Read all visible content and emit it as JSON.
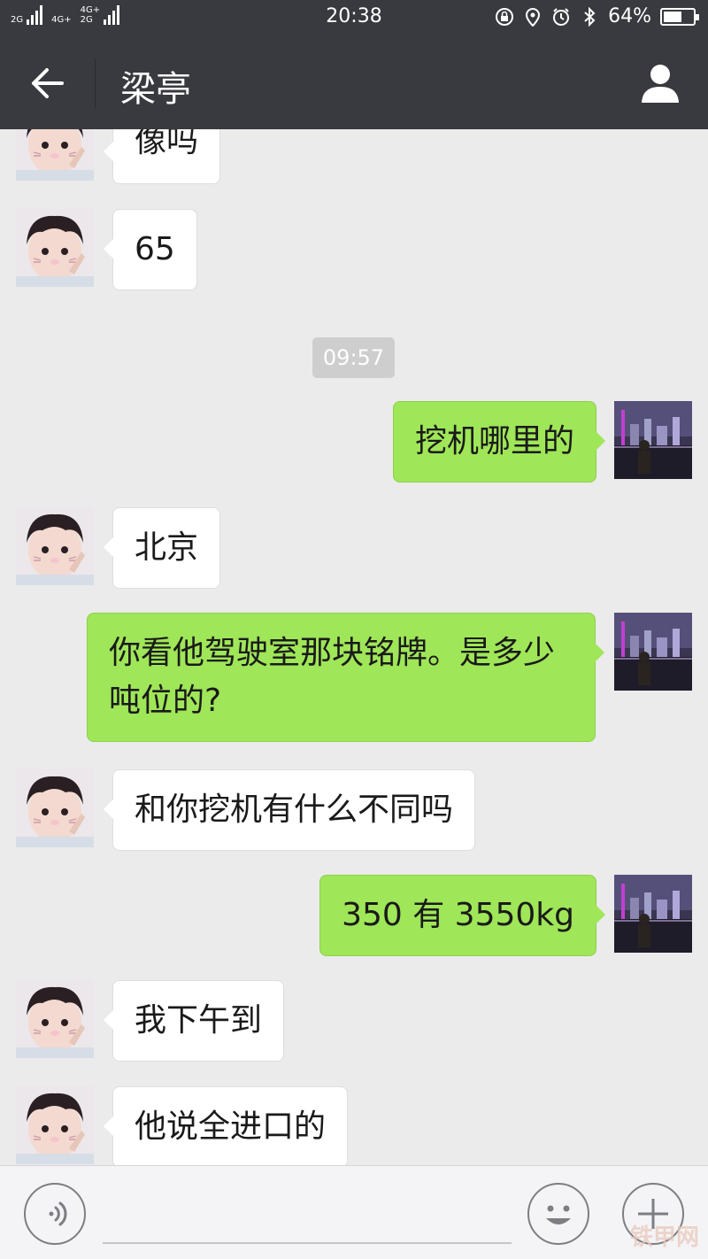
{
  "status_bar": {
    "left_signals": [
      {
        "top": "2G",
        "bottom": ""
      },
      {
        "top": "4G+",
        "bottom": ""
      },
      {
        "top": "4G+",
        "bottom": "2G"
      }
    ],
    "time": "20:38",
    "battery_percent_text": "64%",
    "battery_level": 0.64,
    "icons": [
      "lock-rotation-icon",
      "location-icon",
      "alarm-icon",
      "bluetooth-icon",
      "battery-icon"
    ]
  },
  "nav": {
    "title": "梁亭",
    "back_icon": "back-arrow-icon",
    "profile_icon": "person-icon"
  },
  "messages": [
    {
      "side": "left",
      "text": "像吗"
    },
    {
      "side": "left",
      "text": "65"
    },
    {
      "side": "right",
      "text": "挖机哪里的"
    },
    {
      "side": "left",
      "text": "北京"
    },
    {
      "side": "right",
      "text": "你看他驾驶室那块铭牌。是多少吨位的?"
    },
    {
      "side": "left",
      "text": "和你挖机有什么不同吗"
    },
    {
      "side": "right",
      "text": "350 有 3550kg"
    },
    {
      "side": "left",
      "text": "我下午到"
    },
    {
      "side": "left",
      "text": "他说全进口的"
    }
  ],
  "timestamp": "09:57",
  "input_bar": {
    "placeholder": "",
    "voice_icon": "voice-icon",
    "emoji_icon": "emoji-icon",
    "more_icon": "plus-icon"
  },
  "watermark": "铁甲网",
  "colors": {
    "header_bg": "#393a3f",
    "chat_bg": "#ebebeb",
    "bubble_self": "#9fe658",
    "bubble_other": "#ffffff"
  }
}
